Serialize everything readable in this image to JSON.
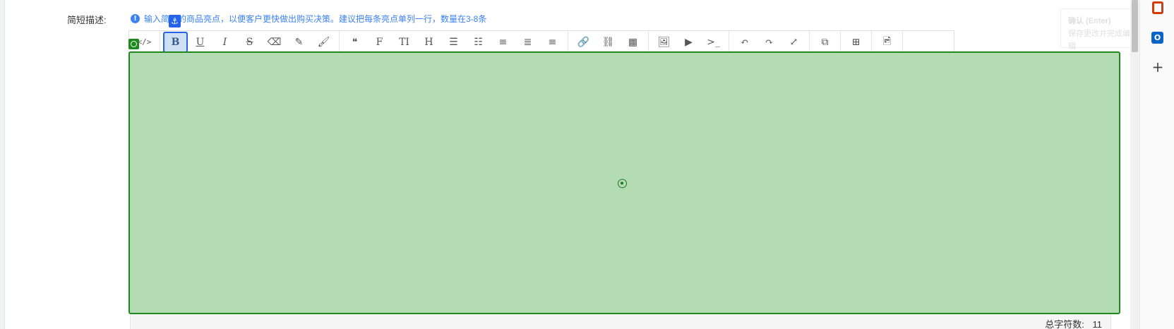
{
  "form": {
    "label": "简短描述:",
    "hint": "输入简短的商品亮点，以便客户更快做出购买决策。建议把每条亮点单列一行，数量在3-8条"
  },
  "toolbar": {
    "groups": [
      [
        {
          "name": "source-code-icon",
          "glyph": "</>"
        }
      ],
      [
        {
          "name": "bold-icon",
          "glyph": "B",
          "active": true
        },
        {
          "name": "underline-icon",
          "glyph": "U"
        },
        {
          "name": "italic-icon",
          "glyph": "I"
        },
        {
          "name": "strikethrough-icon",
          "glyph": "S"
        },
        {
          "name": "eraser-icon",
          "glyph": "⌫"
        },
        {
          "name": "pen-icon",
          "glyph": "✎"
        },
        {
          "name": "brush-icon",
          "glyph": "🖌"
        }
      ],
      [
        {
          "name": "blockquote-icon",
          "glyph": "❝"
        },
        {
          "name": "font-family-icon",
          "glyph": "F"
        },
        {
          "name": "font-size-icon",
          "glyph": "TI"
        },
        {
          "name": "heading-icon",
          "glyph": "H"
        },
        {
          "name": "unordered-list-icon",
          "glyph": "☰"
        },
        {
          "name": "ordered-list-icon",
          "glyph": "☷"
        },
        {
          "name": "align-left-icon",
          "glyph": "≡"
        },
        {
          "name": "align-center-icon",
          "glyph": "≣"
        },
        {
          "name": "align-right-icon",
          "glyph": "≡"
        }
      ],
      [
        {
          "name": "link-icon",
          "glyph": "🔗"
        },
        {
          "name": "unlink-icon",
          "glyph": "⛓"
        },
        {
          "name": "table-icon",
          "glyph": "▦"
        }
      ],
      [
        {
          "name": "image-icon",
          "glyph": "🖼"
        },
        {
          "name": "video-icon",
          "glyph": "▶"
        },
        {
          "name": "code-block-icon",
          "glyph": ">_"
        }
      ],
      [
        {
          "name": "undo-icon",
          "glyph": "↶"
        },
        {
          "name": "redo-icon",
          "glyph": "↷"
        },
        {
          "name": "fullscreen-icon",
          "glyph": "⤢"
        }
      ],
      [
        {
          "name": "gallery-icon",
          "glyph": "⧉"
        }
      ],
      [
        {
          "name": "widgets-icon",
          "glyph": "⊞"
        }
      ],
      [
        {
          "name": "image-edit-icon",
          "glyph": "🖻"
        }
      ]
    ]
  },
  "status": {
    "char_count_label": "总字符数:",
    "char_count_value": "11"
  },
  "tooltip": {
    "title": "确认 (Enter)",
    "body": "保存更改并完成编辑"
  },
  "rail": {
    "outlook_letter": "O",
    "plus": "+"
  },
  "colors": {
    "accent": "#2563eb",
    "hint_blue": "#3b82f6",
    "content_fill": "#b4dcb4",
    "content_border": "#1e8a1e"
  }
}
